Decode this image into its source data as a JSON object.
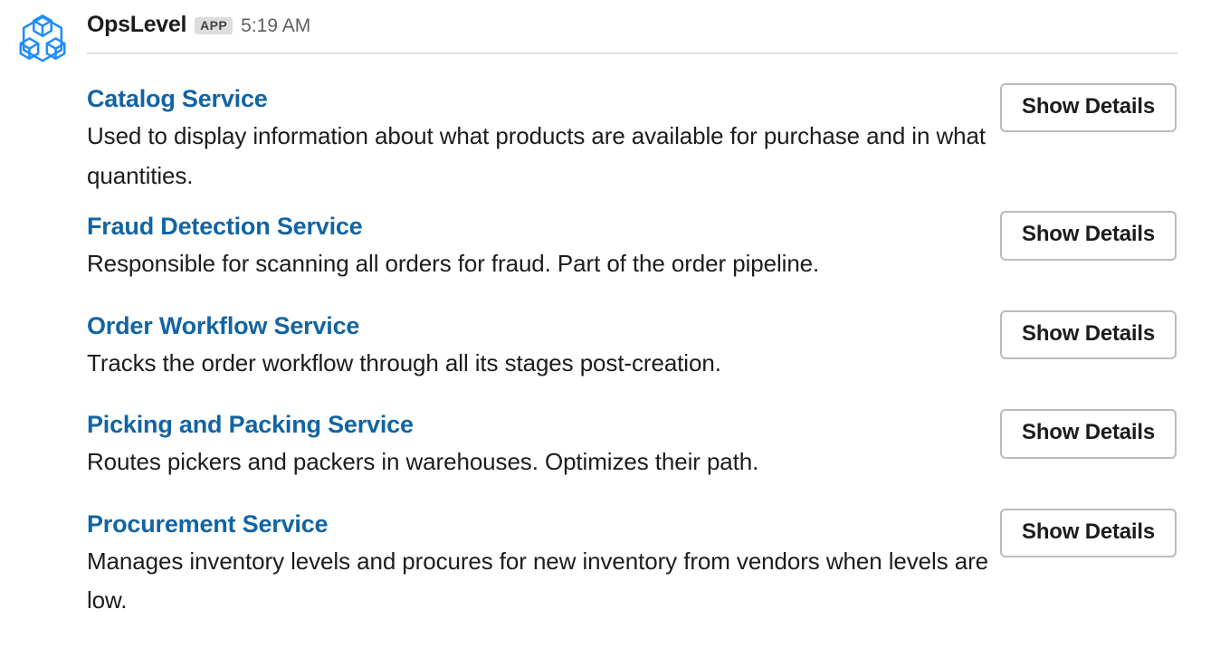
{
  "message": {
    "app_name": "OpsLevel",
    "badge": "APP",
    "timestamp": "5:19 AM",
    "avatar_icon": "opslevel-cubes-logo-icon"
  },
  "colors": {
    "link_blue": "#1264a3",
    "logo_blue": "#1f8cfc",
    "text": "#1d1c1d",
    "muted": "#616061",
    "badge_bg": "#dddddd",
    "border": "#bbbbbb",
    "divider": "#e0e0e0"
  },
  "attachments": [
    {
      "title": "Catalog Service",
      "text": "Used to display information about what products are available for purchase and in what quantities.",
      "action_label": "Show Details"
    },
    {
      "title": "Fraud Detection Service",
      "text": "Responsible for scanning all orders for fraud. Part of the order pipeline.",
      "action_label": "Show Details"
    },
    {
      "title": "Order Workflow Service",
      "text": "Tracks the order workflow through all its stages post-creation.",
      "action_label": "Show Details"
    },
    {
      "title": "Picking and Packing Service",
      "text": "Routes pickers and packers in warehouses. Optimizes their path.",
      "action_label": "Show Details"
    },
    {
      "title": "Procurement Service",
      "text": "Manages inventory levels and procures for new inventory from vendors when levels are low.",
      "action_label": "Show Details"
    }
  ]
}
